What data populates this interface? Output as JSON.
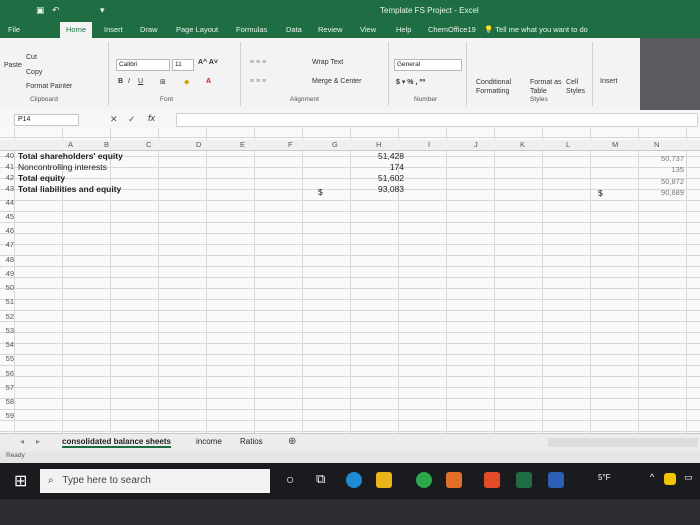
{
  "window": {
    "title": "Template FS Project  -  Excel"
  },
  "ribbon_tabs": [
    "File",
    "Home",
    "Insert",
    "Draw",
    "Page Layout",
    "Formulas",
    "Data",
    "Review",
    "View",
    "Help",
    "ChemOffice19"
  ],
  "tell_me": "Tell me what you want to do",
  "ribbon": {
    "cut": "Cut",
    "copy": "Copy",
    "paste": "Paste",
    "format_painter": "Format Painter",
    "clipboard_group": "Clipboard",
    "font_name": "Calibri",
    "font_size": "11",
    "font_group": "Font",
    "wrap_text": "Wrap Text",
    "merge_center": "Merge & Center",
    "alignment_group": "Alignment",
    "number_format": "General",
    "number_group": "Number",
    "conditional_formatting": "Conditional Formatting",
    "format_as_table": "Format as Table",
    "cell_styles": "Cell Styles",
    "styles_group": "Styles",
    "insert": "Insert"
  },
  "name_box": "P14",
  "columns": [
    "A",
    "B",
    "C",
    "D",
    "E",
    "F",
    "G",
    "H",
    "I",
    "J",
    "K",
    "L",
    "M",
    "N"
  ],
  "rows": [
    {
      "num": "40",
      "label": "Total shareholders' equity",
      "bold": true,
      "h": "51,428",
      "n": "50,737",
      "dollar": false
    },
    {
      "num": "41",
      "label": "Noncontrolling interests",
      "bold": false,
      "h": "174",
      "n": "135",
      "dollar": false
    },
    {
      "num": "42",
      "label": "Total equity",
      "bold": true,
      "h": "51,602",
      "n": "50,872",
      "dollar": false
    },
    {
      "num": "43",
      "label": "Total liabilities and equity",
      "bold": true,
      "h": "93,083",
      "n": "90,689",
      "dollar": true
    }
  ],
  "empty_rows": [
    "44",
    "45",
    "46",
    "47",
    "48",
    "49",
    "50",
    "51",
    "52",
    "53",
    "54",
    "55",
    "56",
    "57",
    "58",
    "59"
  ],
  "currency_symbol": "$",
  "sheet_tabs": [
    "consolidated balance sheets",
    "income",
    "Ratios"
  ],
  "status": "Ready",
  "taskbar": {
    "search_placeholder": "Type here to search",
    "temperature": "5°F"
  }
}
